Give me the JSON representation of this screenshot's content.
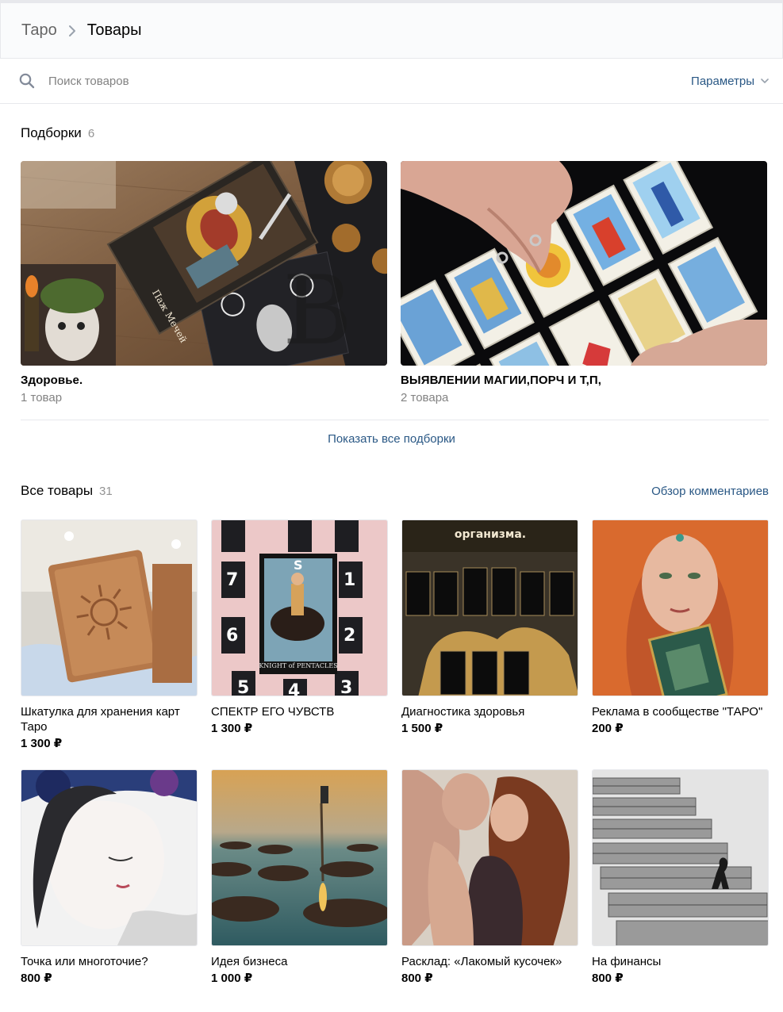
{
  "breadcrumb": {
    "parent": "Таро",
    "current": "Товары"
  },
  "search": {
    "placeholder": "Поиск товаров",
    "params_label": "Параметры"
  },
  "collections": {
    "title": "Подборки",
    "count": "6",
    "items": [
      {
        "name": "Здоровье.",
        "sub": "1 товар"
      },
      {
        "name": "ВЫЯВЛЕНИИ МАГИИ,ПОРЧ И Т,П,",
        "sub": "2 товара"
      }
    ],
    "show_all": "Показать все подборки"
  },
  "all_products": {
    "title": "Все товары",
    "count": "31",
    "reviews_link": "Обзор комментариев",
    "items": [
      {
        "title": "Шкатулка для хранения карт Таро",
        "price": "1 300 ₽"
      },
      {
        "title": "СПЕКТР ЕГО ЧУВСТВ",
        "price": "1 300 ₽"
      },
      {
        "title": "Диагностика здоровья",
        "price": "1 500 ₽"
      },
      {
        "title": "Реклама в сообществе \"ТАРО\"",
        "price": "200 ₽"
      },
      {
        "title": "Точка или многоточие?",
        "price": "800 ₽"
      },
      {
        "title": "Идея бизнеса",
        "price": "1 000 ₽"
      },
      {
        "title": "Расклад: «Лакомый кусочек»",
        "price": "800 ₽"
      },
      {
        "title": "На финансы",
        "price": "800 ₽"
      }
    ]
  },
  "image_text": {
    "card_page_of_swords": "Паж Мечей",
    "card_knight": "KNIGHT of PENTACLES",
    "diag_header": "организма."
  },
  "colors": {
    "link": "#2a5885",
    "muted": "#828282",
    "border": "#e7e8ec"
  }
}
